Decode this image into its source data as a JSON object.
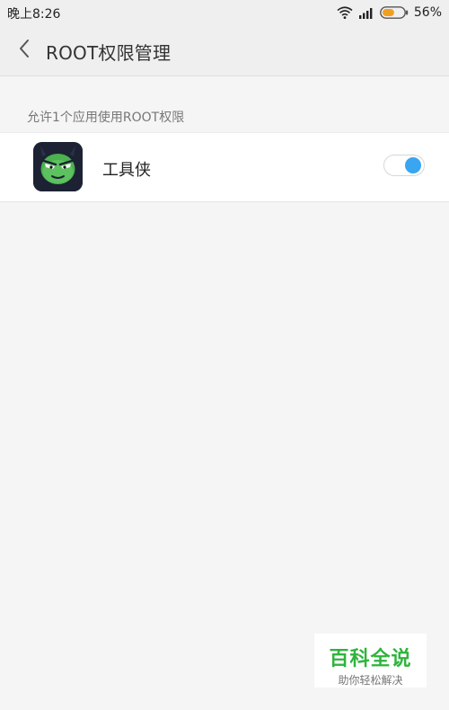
{
  "status_bar": {
    "time": "晚上8:26",
    "battery_percent_text": "56%",
    "battery_level": 0.56,
    "icons": [
      "wifi-icon",
      "signal-icon",
      "battery-icon"
    ]
  },
  "header": {
    "back_icon": "chevron-left-icon",
    "title": "ROOT权限管理"
  },
  "section": {
    "caption": "允许1个应用使用ROOT权限"
  },
  "apps": [
    {
      "name": "工具侠",
      "icon": "green-face-app-icon",
      "root_allowed": true
    }
  ],
  "colors": {
    "toggle_on": "#3aa5f0",
    "battery_fill": "#f0a020",
    "watermark_green": "#2fb43c"
  },
  "watermark": {
    "title": "百科全说",
    "subtitle": "助你轻松解决"
  }
}
